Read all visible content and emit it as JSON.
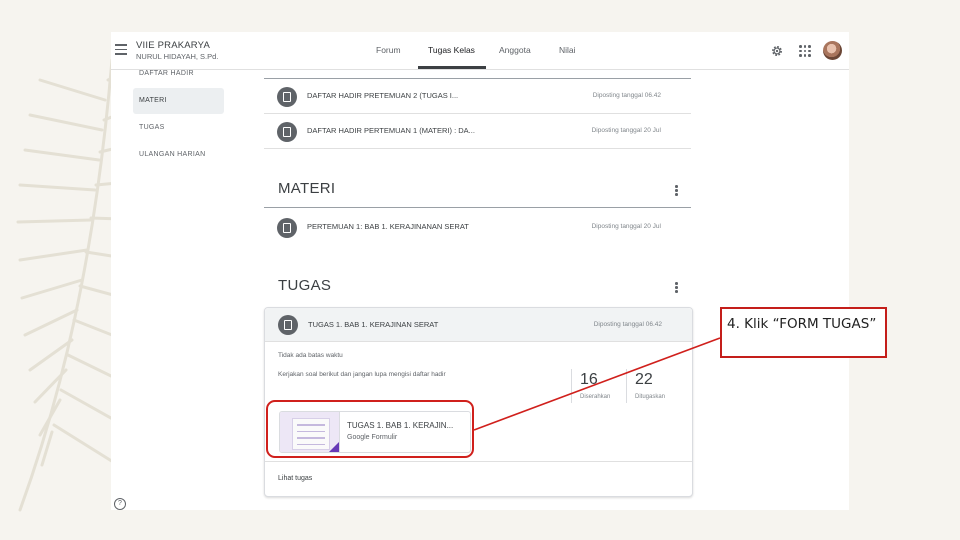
{
  "header": {
    "class_name": "VIIE PRAKARYA",
    "teacher": "NURUL HIDAYAH, S.Pd.",
    "tabs": [
      {
        "label": "Forum"
      },
      {
        "label": "Tugas Kelas"
      },
      {
        "label": "Anggota"
      },
      {
        "label": "Nilai"
      }
    ],
    "active_tab": "Tugas Kelas"
  },
  "sidebar": {
    "items": [
      {
        "label": "DAFTAR HADIR"
      },
      {
        "label": "MATERI"
      },
      {
        "label": "TUGAS"
      },
      {
        "label": "ULANGAN HARIAN"
      }
    ],
    "active": "MATERI"
  },
  "daftar_hadir": {
    "rows": [
      {
        "title": "DAFTAR HADIR PRETEMUAN 2 (TUGAS I...",
        "date": "Diposting tanggal 06.42"
      },
      {
        "title": "DAFTAR HADIR PERTEMUAN 1 (MATERI) : DA...",
        "date": "Diposting tanggal 20 Jul"
      }
    ]
  },
  "materi": {
    "heading": "MATERI",
    "rows": [
      {
        "title": "PERTEMUAN 1: BAB 1. KERAJINANAN SERAT",
        "date": "Diposting tanggal 20 Jul"
      }
    ]
  },
  "tugas": {
    "heading": "TUGAS",
    "card": {
      "title": "TUGAS 1. BAB 1. KERAJINAN SERAT",
      "date": "Diposting tanggal 06.42",
      "due": "Tidak ada batas waktu",
      "instructions": "Kerjakan soal berikut dan jangan lupa mengisi daftar hadir",
      "stats": [
        {
          "value": "16",
          "label": "Diserahkan"
        },
        {
          "value": "22",
          "label": "Ditugaskan"
        }
      ],
      "attachment": {
        "title": "TUGAS 1. BAB 1. KERAJIN...",
        "type": "Google Formulir"
      },
      "footer_link": "Lihat tugas"
    }
  },
  "annotation": {
    "callout_text": "4. Klik “FORM TUGAS”",
    "color": "#d0201c"
  },
  "colors": {
    "page_bg": "#f6f4ef",
    "accent_dark": "#5f6368",
    "form_purple": "#673ab7"
  }
}
